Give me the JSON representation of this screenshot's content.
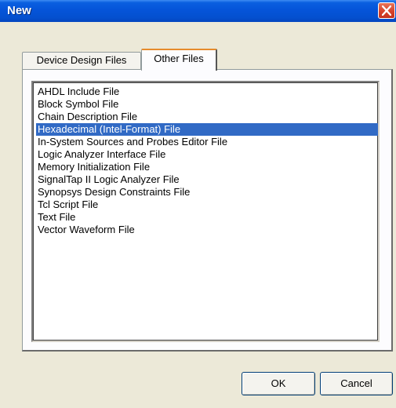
{
  "window": {
    "title": "New"
  },
  "tabs": [
    {
      "label": "Device Design Files",
      "active": false
    },
    {
      "label": "Other Files",
      "active": true
    }
  ],
  "file_list": {
    "items": [
      "AHDL Include File",
      "Block Symbol File",
      "Chain Description File",
      "Hexadecimal (Intel-Format) File",
      "In-System Sources and Probes Editor File",
      "Logic Analyzer Interface File",
      "Memory Initialization File",
      "SignalTap II Logic Analyzer File",
      "Synopsys Design Constraints File",
      "Tcl Script File",
      "Text File",
      "Vector Waveform File"
    ],
    "selected": "Hexadecimal (Intel-Format) File"
  },
  "buttons": {
    "ok": "OK",
    "cancel": "Cancel"
  },
  "icons": {
    "close": "close-icon"
  },
  "colors": {
    "titlebar": "#0554d9",
    "selection": "#316ac5",
    "close_button": "#d6422b",
    "active_tab_highlight": "#e68b2c"
  }
}
